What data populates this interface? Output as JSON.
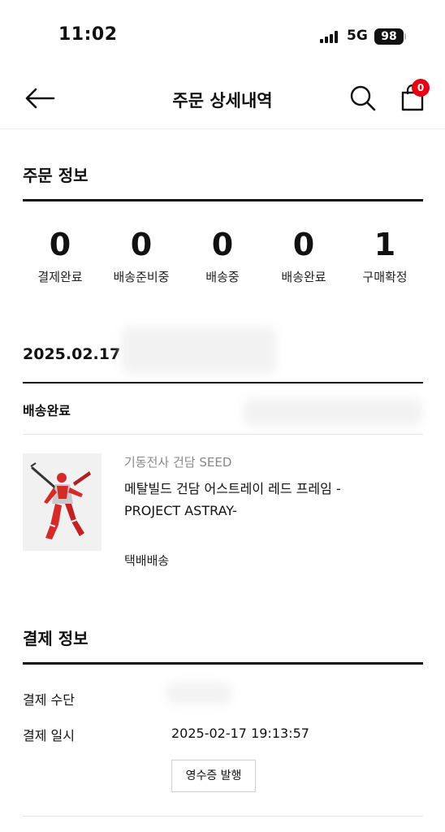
{
  "status_bar": {
    "time": "11:02",
    "network": "5G",
    "battery": "98"
  },
  "nav": {
    "title": "주문 상세내역",
    "cart_count": "0"
  },
  "order_info": {
    "title": "주문 정보",
    "stats": [
      {
        "count": "0",
        "label": "결제완료"
      },
      {
        "count": "0",
        "label": "배송준비중"
      },
      {
        "count": "0",
        "label": "배송중"
      },
      {
        "count": "0",
        "label": "배송완료"
      },
      {
        "count": "1",
        "label": "구매확정"
      }
    ],
    "date": "2025.02.17",
    "status": "배송완료",
    "product": {
      "brand": "기동전사 건담 SEED",
      "name": "메탈빌드 건담 어스트레이 레드 프레임 -PROJECT ASTRAY-",
      "shipping": "택배배송"
    }
  },
  "payment_info": {
    "title": "결제 정보",
    "method_label": "결제 수단",
    "datetime_label": "결제 일시",
    "datetime_value": "2025-02-17 19:13:57",
    "receipt_button": "영수증 발행"
  }
}
